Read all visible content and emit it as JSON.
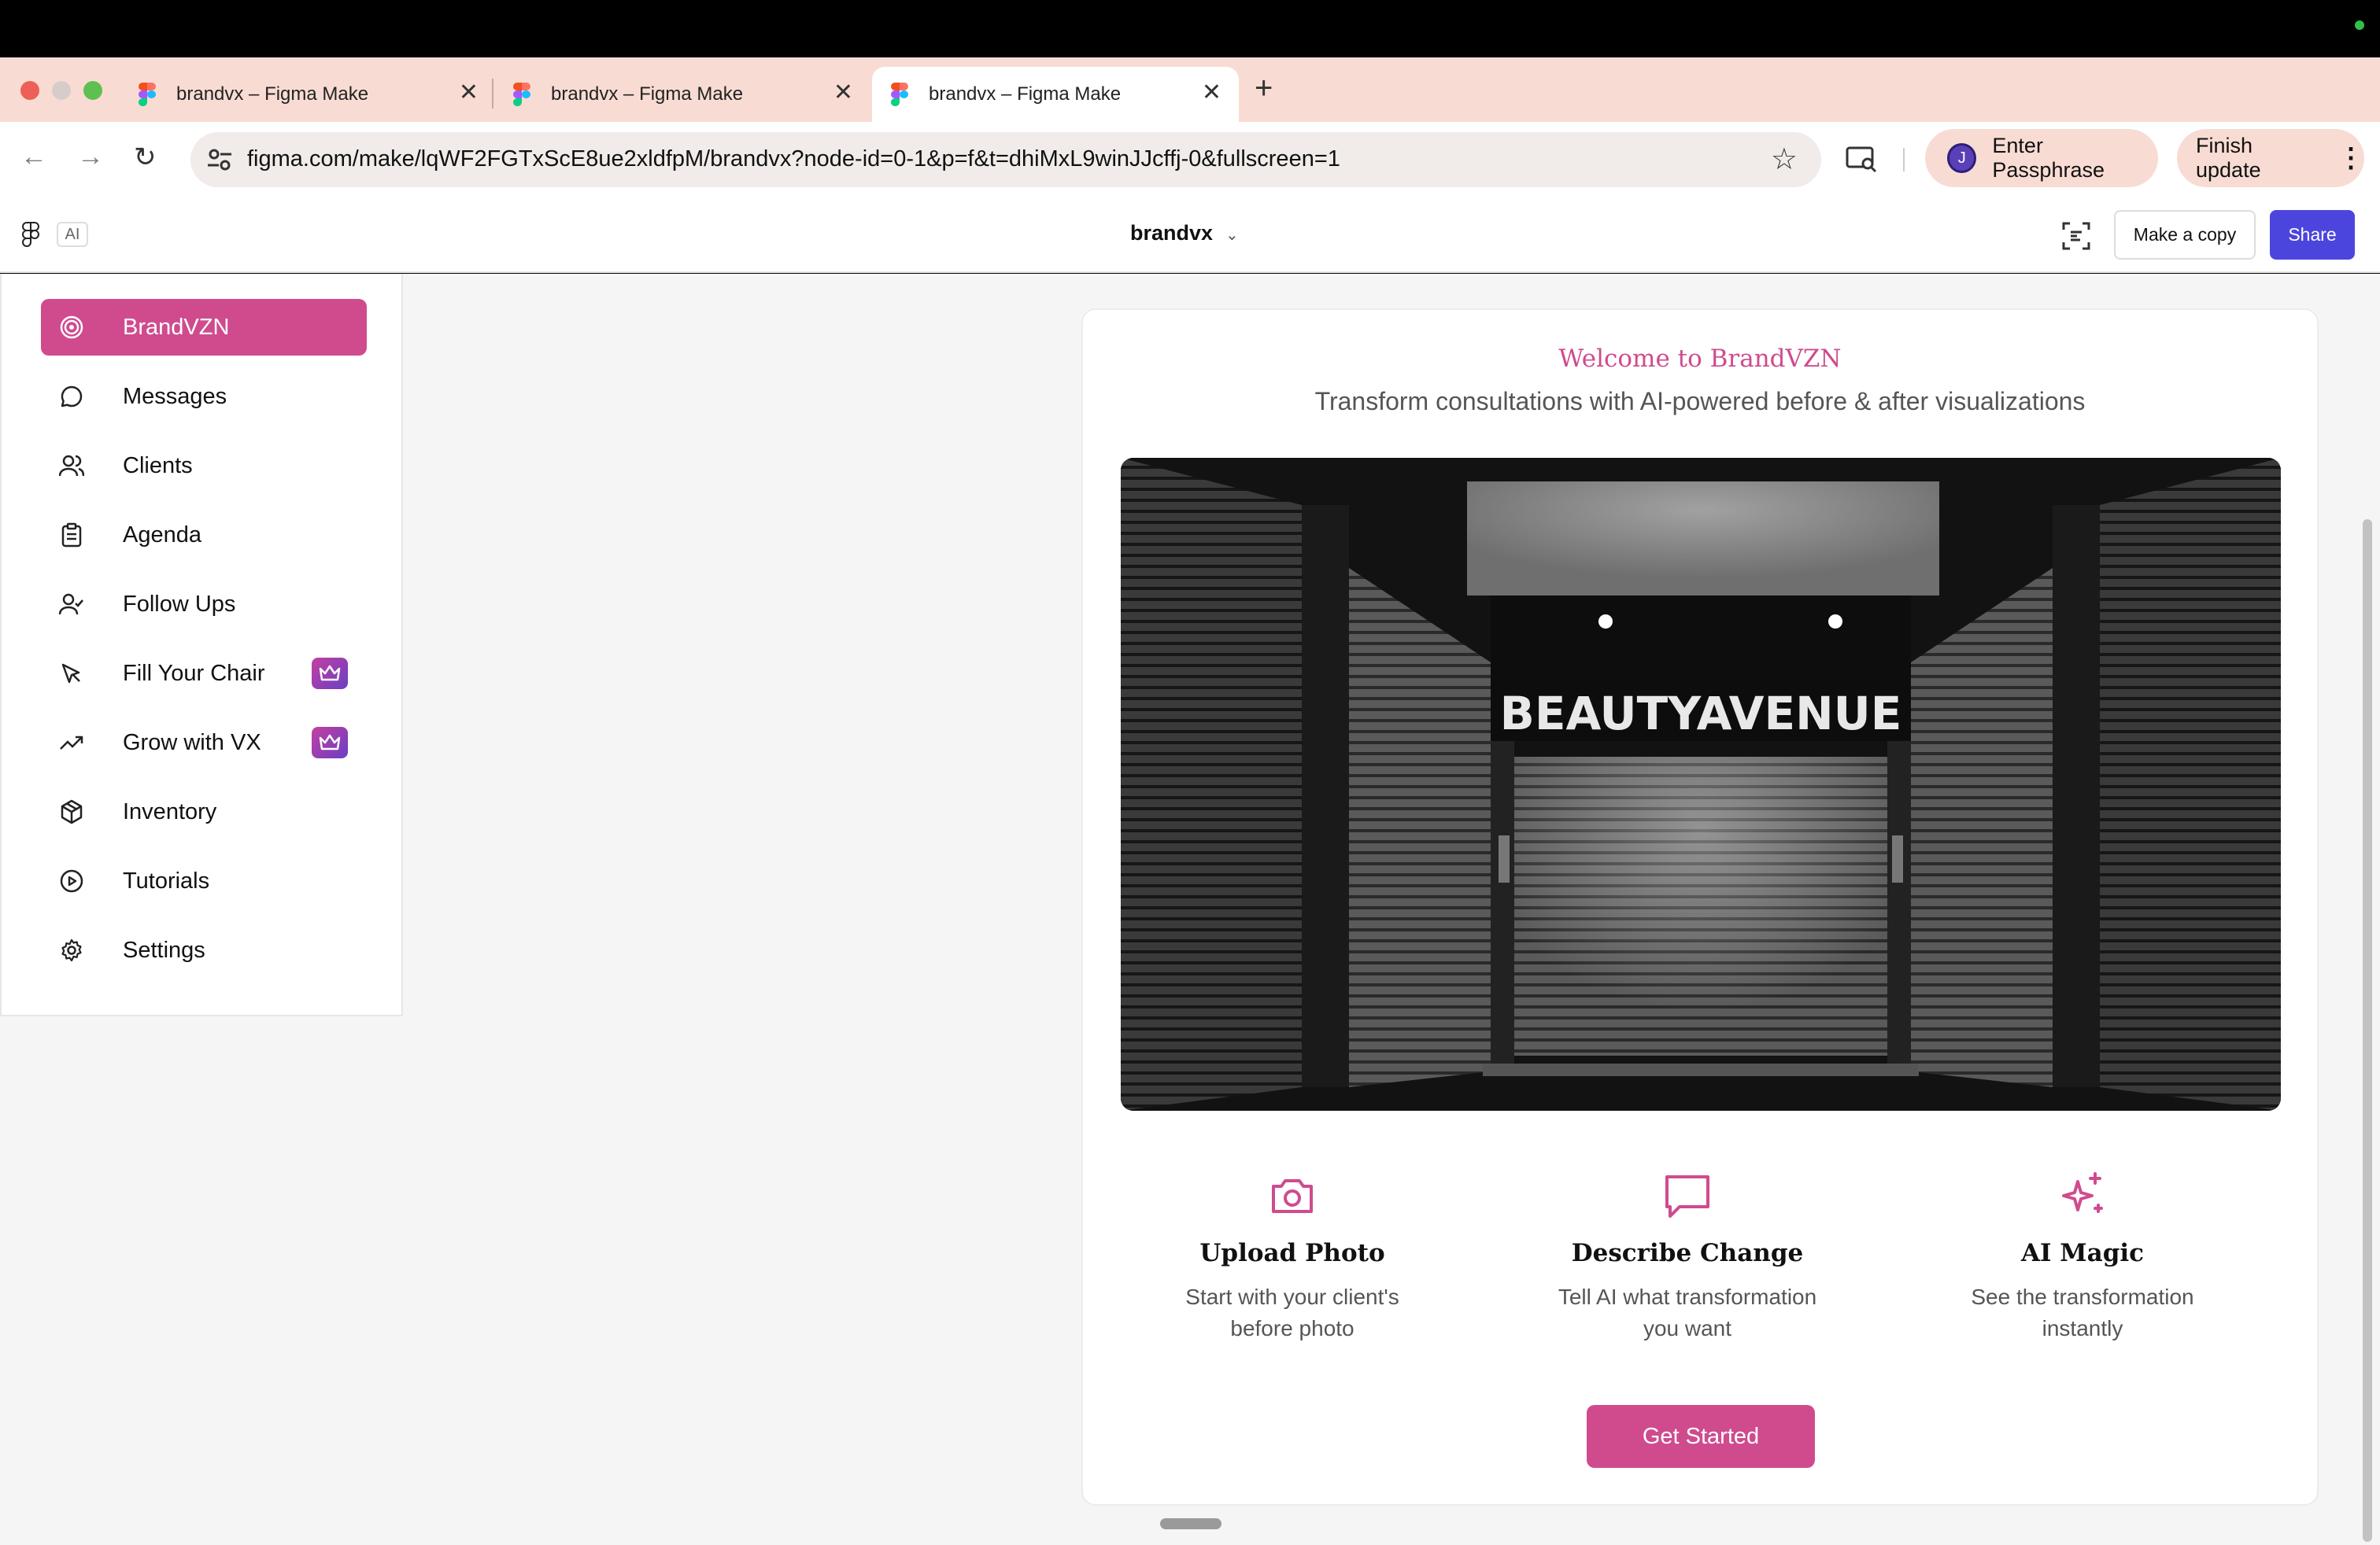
{
  "browser": {
    "tabs": [
      {
        "title": "brandvx – Figma Make",
        "close": "✕"
      },
      {
        "title": "brandvx – Figma Make",
        "close": "✕"
      },
      {
        "title": "brandvx – Figma Make",
        "close": "✕"
      }
    ],
    "new_tab": "+",
    "url": "figma.com/make/lqWF2FGTxScE8ue2xldfpM/brandvx?node-id=0-1&p=f&t=dhiMxL9winJJcffj-0&fullscreen=1",
    "profile_initial": "J",
    "passphrase_label": "Enter Passphrase",
    "update_label": "Finish update"
  },
  "figma": {
    "ai_badge": "AI",
    "file_name": "brandvx",
    "make_copy": "Make a copy",
    "share": "Share"
  },
  "sidebar": {
    "items": [
      {
        "label": "BrandVZN",
        "icon": "target-icon",
        "active": true
      },
      {
        "label": "Messages",
        "icon": "message-circle-icon"
      },
      {
        "label": "Clients",
        "icon": "users-icon"
      },
      {
        "label": "Agenda",
        "icon": "clipboard-icon"
      },
      {
        "label": "Follow Ups",
        "icon": "user-check-icon"
      },
      {
        "label": "Fill Your Chair",
        "icon": "cursor-icon",
        "badge": "crown-icon"
      },
      {
        "label": "Grow with VX",
        "icon": "trending-up-icon",
        "badge": "crown-icon"
      },
      {
        "label": "Inventory",
        "icon": "package-icon"
      },
      {
        "label": "Tutorials",
        "icon": "play-circle-icon"
      },
      {
        "label": "Settings",
        "icon": "gear-icon"
      }
    ]
  },
  "main": {
    "welcome": "Welcome to BrandVZN",
    "subtitle": "Transform consultations with AI-powered before & after visualizations",
    "hero_sign": "BEAUTYAVENUE",
    "features": [
      {
        "icon": "camera-icon",
        "title": "Upload Photo",
        "desc": "Start with your client's before photo"
      },
      {
        "icon": "message-square-icon",
        "title": "Describe Change",
        "desc": "Tell AI what transformation you want"
      },
      {
        "icon": "sparkles-icon",
        "title": "AI Magic",
        "desc": "See the transformation instantly"
      }
    ],
    "cta": "Get Started"
  },
  "colors": {
    "accent": "#cf4b8e",
    "share_button": "#4c45dd",
    "tab_strip": "#f8dcd3"
  }
}
